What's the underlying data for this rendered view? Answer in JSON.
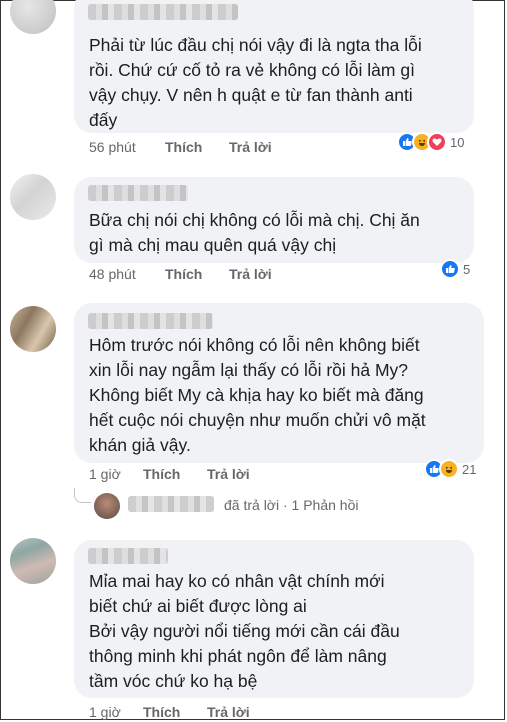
{
  "comments": [
    {
      "lines": [
        "Phải từ lúc đầu chị nói vậy đi là ngta tha lỗi",
        "rồi. Chứ cứ cố tỏ ra vẻ không có lỗi làm gì",
        "vậy chụy. V nên h quật e từ fan thành anti",
        "đấy"
      ],
      "time": "56 phút",
      "like": "Thích",
      "reply": "Trả lời",
      "reactions": [
        "like",
        "haha",
        "love"
      ],
      "reaction_count": "10"
    },
    {
      "lines": [
        "Bữa chị nói chị không có lỗi mà chị. Chị ăn",
        "gì mà chị mau quên quá vậy chị"
      ],
      "time": "48 phút",
      "like": "Thích",
      "reply": "Trả lời",
      "reactions": [
        "like"
      ],
      "reaction_count": "5"
    },
    {
      "lines": [
        "Hôm trước nói không có lỗi nên không biết",
        "xin lỗi nay ngẫm lại thấy có lỗi rồi hả My?",
        "Không biết My cà khịa hay ko biết mà đăng",
        "hết cuộc nói chuyện như muốn chửi vô mặt",
        "khán giả vậy."
      ],
      "time": "1 giờ",
      "like": "Thích",
      "reply": "Trả lời",
      "reactions": [
        "like",
        "haha"
      ],
      "reaction_count": "21",
      "replies": {
        "text": "đã trả lời",
        "separator": "·",
        "count": "1 Phản hồi"
      }
    },
    {
      "lines": [
        "Mỉa mai hay ko có nhân vật chính mới",
        "biết chứ ai  biết được lòng ai",
        "Bởi vậy người nổi tiếng mới cần cái đầu",
        "thông minh  khi  phát ngôn  để làm nâng",
        "tầm vóc chứ ko hạ bệ"
      ],
      "time": "1 giờ",
      "like": "Thích",
      "reply": "Trả lời"
    }
  ],
  "colors": {
    "bubble": "#f0f2f5",
    "text": "#1c1e21",
    "meta": "#65676b",
    "like": "#1877f2",
    "haha": "#f7b125",
    "love": "#f33e58"
  }
}
